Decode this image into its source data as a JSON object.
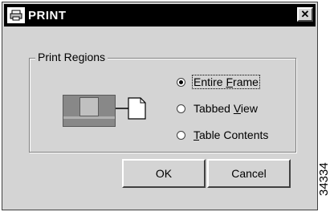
{
  "window": {
    "title": "PRINT",
    "close_label": "✕"
  },
  "group": {
    "label": "Print Regions"
  },
  "options": [
    {
      "label_pre": "Entire ",
      "mnemonic": "F",
      "label_post": "rame",
      "selected": true
    },
    {
      "label_pre": "Tabbed ",
      "mnemonic": "V",
      "label_post": "iew",
      "selected": false
    },
    {
      "label_pre": "",
      "mnemonic": "T",
      "label_post": "able Contents",
      "selected": false
    }
  ],
  "buttons": {
    "ok": "OK",
    "cancel": "Cancel"
  },
  "figure_id": "34334"
}
